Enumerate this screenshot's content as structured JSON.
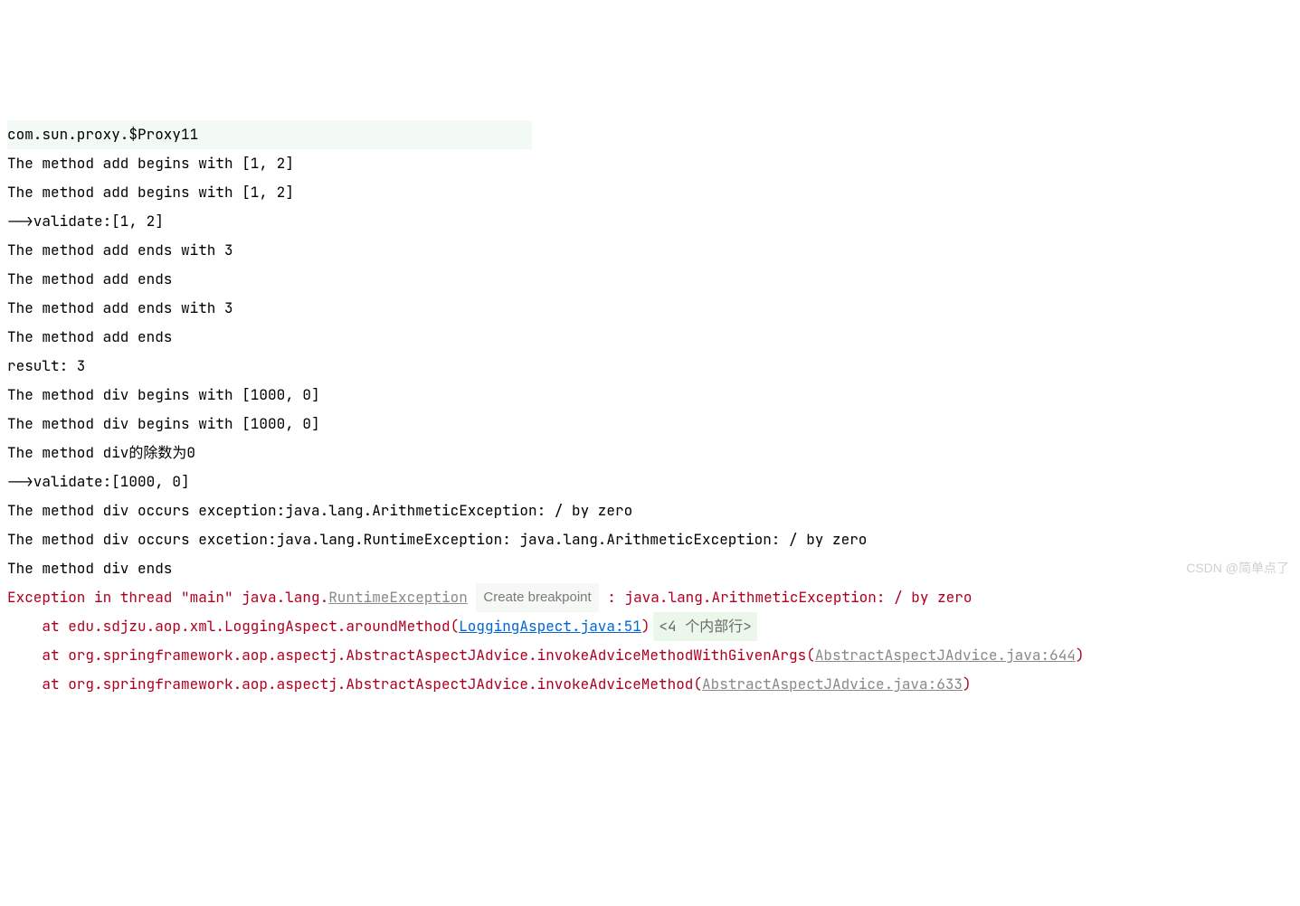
{
  "lines": {
    "l0": "com.sun.proxy.$Proxy11",
    "l1": "The method add begins with [1, 2]",
    "l2": "The method add begins with [1, 2]",
    "l3": "-->validate:[1, 2]",
    "l4": "The method add ends with 3",
    "l5": "The method add ends",
    "l6": "The method add ends with 3",
    "l7": "The method add ends",
    "l8": "result: 3",
    "l9": "The method div begins with [1000, 0]",
    "l10": "The method div begins with [1000, 0]",
    "l11": "The method div的除数为0",
    "l12": "-->validate:[1000, 0]",
    "l13": "The method div occurs exception:java.lang.ArithmeticException: / by zero",
    "l14": "The method div occurs excetion:java.lang.RuntimeException: java.lang.ArithmeticException: / by zero",
    "l15": "The method div ends"
  },
  "exception": {
    "prefix": "Exception in thread \"main\" java.lang.",
    "class": "RuntimeException",
    "breakpoint": "Create breakpoint",
    "suffix": " : java.lang.ArithmeticException: / by zero"
  },
  "stack": {
    "s1_prefix": "    at edu.sdjzu.aop.xml.LoggingAspect.aroundMethod(",
    "s1_link": "LoggingAspect.java:51",
    "s1_close": ")",
    "s1_internal": "<4 个内部行>",
    "s2_prefix": "    at org.springframework.aop.aspectj.AbstractAspectJAdvice.invokeAdviceMethodWithGivenArgs(",
    "s2_link": "AbstractAspectJAdvice.java:644",
    "s2_close": ")",
    "s3_prefix": "    at org.springframework.aop.aspectj.AbstractAspectJAdvice.invokeAdviceMethod(",
    "s3_link": "AbstractAspectJAdvice.java:633",
    "s3_close": ")"
  },
  "watermark": "CSDN @简单点了"
}
